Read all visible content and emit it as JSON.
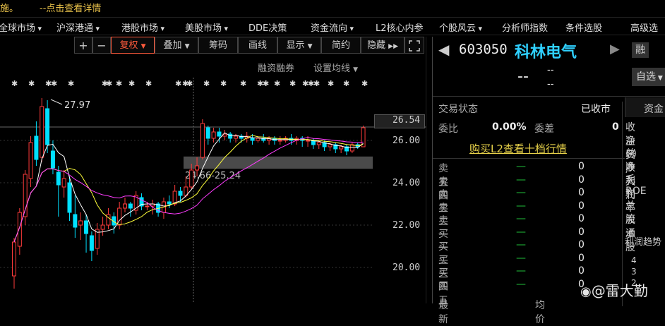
{
  "notice": {
    "left_text": "施。",
    "link_text": "--点击查看详情"
  },
  "menu": [
    {
      "label": "全球市场",
      "x": -2
    },
    {
      "label": "沪深港通",
      "x": 80
    },
    {
      "label": "港股市场",
      "x": 172
    },
    {
      "label": "美股市场",
      "x": 262
    },
    {
      "label": "DDE决策",
      "x": 352
    },
    {
      "label": "资金流向",
      "x": 440
    },
    {
      "label": "L2核心内参",
      "x": 532
    },
    {
      "label": "个股风云",
      "x": 622
    },
    {
      "label": "分析师指数",
      "x": 711
    },
    {
      "label": "条件选股",
      "x": 801
    },
    {
      "label": "高级选",
      "x": 893
    }
  ],
  "toolbar": {
    "plus": "+",
    "minus": "−",
    "fuquan": "复权",
    "diejia": "叠加",
    "chouma": "筹码",
    "huaxian": "画线",
    "xianshi": "显示",
    "jianyue": "简约",
    "yincang": "隐藏",
    "rzrq": "融资融券",
    "junxian": "设置均线"
  },
  "chart": {
    "high_label": "27.97",
    "current_price": "26.54",
    "gap_label": "24.66-25.24",
    "y_ticks": [
      "26.00",
      "24.00",
      "22.00",
      "20.00"
    ]
  },
  "stock": {
    "code": "603050",
    "name": "科林电气",
    "rong": "融",
    "price": "--",
    "chg1": "--",
    "chg2": "--",
    "zixuan": "自选",
    "trade_status_label": "交易状态",
    "trade_status": "已收市",
    "weibi_label": "委比",
    "weibi": "0.00%",
    "weicha_label": "委差",
    "weicha": "0",
    "l2_link": "购买L2查看十档行情"
  },
  "orders": [
    {
      "label": "卖五",
      "price": "—",
      "vol": "0"
    },
    {
      "label": "卖四",
      "price": "—",
      "vol": "0"
    },
    {
      "label": "卖三",
      "price": "—",
      "vol": "0"
    },
    {
      "label": "卖二",
      "price": "—",
      "vol": "0"
    },
    {
      "label": "卖一",
      "price": "—",
      "vol": "0"
    },
    {
      "label": "买一",
      "price": "—",
      "vol": "0"
    },
    {
      "label": "买二",
      "price": "—",
      "vol": "0"
    },
    {
      "label": "买三",
      "price": "—",
      "vol": "0"
    },
    {
      "label": "买四",
      "price": "—",
      "vol": "0"
    },
    {
      "label": "买五",
      "price": "—",
      "vol": "0"
    }
  ],
  "bottom_row": {
    "label": "最新",
    "val": "均价"
  },
  "side": {
    "tab": "资金",
    "items": [
      "收益(-)",
      "净资产",
      "总收入",
      "净利润",
      "毛利率",
      "ROE",
      "总股本",
      "流通股"
    ],
    "trend": "利润趋势",
    "axis": [
      "4",
      "3",
      "2"
    ]
  },
  "watermark": "@雷大勤",
  "colors": {
    "up": "#ff3b3b",
    "down": "#00e0ff",
    "ma5": "#ffffff",
    "ma10": "#ffff3a",
    "ma20": "#ff3cff",
    "accent": "#2fd0ff"
  }
}
